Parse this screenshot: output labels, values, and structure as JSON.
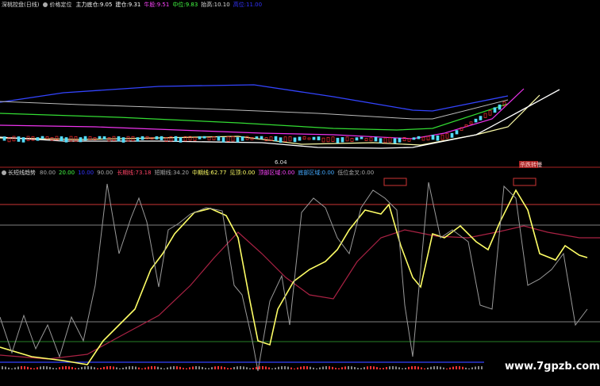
{
  "top_panel": {
    "indicator": "深桃控盘(日线)",
    "sub": "价格定位",
    "items": [
      {
        "label": "主力底仓:",
        "value": "9.05",
        "color": "#ffffff"
      },
      {
        "label": "建仓:",
        "value": "9.31",
        "color": "#ffffff"
      },
      {
        "label": "牛股:",
        "value": "9.51",
        "color": "#ff44ff"
      },
      {
        "label": "中位:",
        "value": "9.83",
        "color": "#44ff44"
      },
      {
        "label": "抬高:",
        "value": "10.10",
        "color": "#dddddd"
      },
      {
        "label": "高位:",
        "value": "11.00",
        "color": "#3333ff"
      }
    ],
    "low_price": "6.04",
    "tag": "杀跌转慢"
  },
  "bottom_panel": {
    "indicator": "长短线趋势",
    "levels": [
      {
        "value": "80.00",
        "color": "#aaaaaa"
      },
      {
        "value": "20.00",
        "color": "#44ff44"
      },
      {
        "value": "10.00",
        "color": "#3333ff"
      },
      {
        "value": "90.00",
        "color": "#aaaaaa"
      }
    ],
    "items": [
      {
        "label": "长期线:",
        "value": "73.18",
        "color": "#ff4466"
      },
      {
        "label": "短期线:",
        "value": "34.20",
        "color": "#aaaaaa"
      },
      {
        "label": "中期线:",
        "value": "62.77",
        "color": "#ffff66"
      },
      {
        "label": "见顶:",
        "value": "0.00",
        "color": "#ffff66"
      },
      {
        "label": "顶部区域:",
        "value": "0.00",
        "color": "#ff44ff"
      },
      {
        "label": "底部区域:",
        "value": "0.00",
        "color": "#44aaff"
      },
      {
        "label": "低位金叉:",
        "value": "0.00",
        "color": "#aaaaaa"
      }
    ]
  },
  "watermark": "www.7gpzb.com"
}
